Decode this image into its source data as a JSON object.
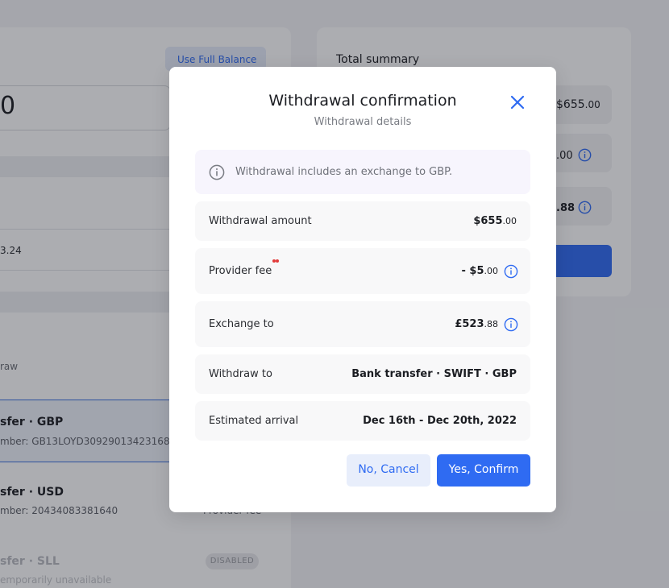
{
  "background": {
    "use_full_balance": "Use Full Balance",
    "amount_fragment": "0",
    "balance_fragment": "3.24",
    "withdraw_fragment": "raw",
    "accounts": [
      {
        "title": "sfer · GBP",
        "subtitle": "mber: GB13LOYD30929013423168",
        "selected": true
      },
      {
        "title": "sfer · USD",
        "subtitle": "mber: 20434083381640",
        "selected": false
      },
      {
        "title": "sfer · SLL",
        "subtitle": "emporarily unavailable",
        "selected": false,
        "badge": "DISABLED"
      }
    ],
    "provider_fee_fragment": "Provider fee",
    "summary": {
      "title": "Total summary",
      "row1_main": "$655",
      "row1_cents": ".00",
      "row2_cents": ".00",
      "row3_cents": ".88"
    }
  },
  "modal": {
    "title": "Withdrawal confirmation",
    "subtitle": "Withdrawal details",
    "info_text": "Withdrawal includes an exchange to GBP.",
    "rows": [
      {
        "label": "Withdrawal amount",
        "value_main": "$655",
        "value_cents": ".00"
      },
      {
        "label": "Provider fee",
        "value_main": "- $5",
        "value_cents": ".00",
        "info_icon": "info-icon"
      },
      {
        "label": "Exchange to",
        "value_main": "£523",
        "value_cents": ".88",
        "info_icon": "info-icon"
      },
      {
        "label": "Withdraw to",
        "value_main": "Bank transfer · SWIFT · GBP"
      },
      {
        "label": "Estimated arrival",
        "value_main": "Dec 16th - Dec 20th, 2022"
      }
    ],
    "cancel_label": "No, Cancel",
    "confirm_label": "Yes, Confirm"
  },
  "colors": {
    "accent": "#2f6bf2",
    "overlay": "rgba(24, 28, 40, 0.36)",
    "info_box_bg": "#f7f5fd",
    "fee_marker": "#e23a3a"
  }
}
